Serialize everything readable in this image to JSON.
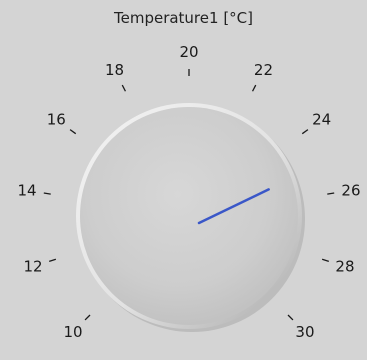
{
  "knob": {
    "title": "Temperature1 [°C]",
    "value": 25.3,
    "min": 10,
    "max": 30,
    "pointer_color": "#3a57c8",
    "ticks": [
      {
        "value": 10,
        "label": "10"
      },
      {
        "value": 12,
        "label": "12"
      },
      {
        "value": 14,
        "label": "14"
      },
      {
        "value": 16,
        "label": "16"
      },
      {
        "value": 18,
        "label": "18"
      },
      {
        "value": 20,
        "label": "20"
      },
      {
        "value": 22,
        "label": "22"
      },
      {
        "value": 24,
        "label": "24"
      },
      {
        "value": 26,
        "label": "26"
      },
      {
        "value": 28,
        "label": "28"
      },
      {
        "value": 30,
        "label": "30"
      }
    ]
  }
}
